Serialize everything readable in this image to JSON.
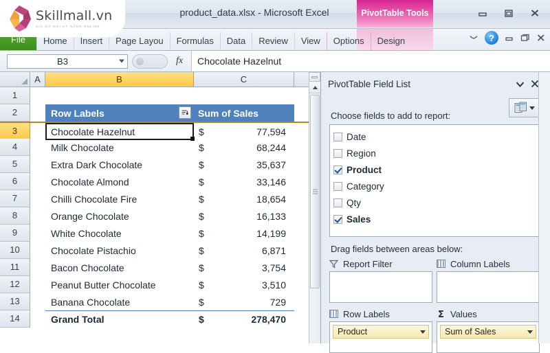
{
  "window": {
    "document_title": "product_data.xlsx - Microsoft Excel",
    "contextual_tab_badge": "PivotTable Tools",
    "minimize_label": "Minimize",
    "restore_label": "Restore Down",
    "close_label": "Close"
  },
  "watermark": {
    "name": "Skillmall.vn",
    "tagline": "GIA SƯ MỌI KỸ NĂNG ONLINE"
  },
  "ribbon": {
    "tabs": [
      {
        "label": "File",
        "type": "file"
      },
      {
        "label": "Home",
        "type": "normal"
      },
      {
        "label": "Insert",
        "type": "normal"
      },
      {
        "label": "Page Layou",
        "type": "normal"
      },
      {
        "label": "Formulas",
        "type": "normal"
      },
      {
        "label": "Data",
        "type": "normal"
      },
      {
        "label": "Review",
        "type": "normal"
      },
      {
        "label": "View",
        "type": "normal"
      },
      {
        "label": "Options",
        "type": "contextual"
      },
      {
        "label": "Design",
        "type": "contextual"
      }
    ],
    "help_label": "?",
    "accent_contextual": "#e0399c",
    "accent_file": "#4f9e27"
  },
  "formula_bar": {
    "name_box_value": "B3",
    "formula_value": "Chocolate Hazelnut",
    "fx_label": "fx"
  },
  "grid": {
    "columns": [
      "A",
      "B",
      "C"
    ],
    "selected_column": "B",
    "selected_row": "3",
    "active_cell": "B3",
    "rows": [
      {
        "num": "1",
        "label": "",
        "currency": "",
        "amount": "",
        "style": "blank"
      },
      {
        "num": "2",
        "label": "Row Labels",
        "currency": "",
        "amount": "Sum of Sales",
        "style": "header"
      },
      {
        "num": "3",
        "label": "Chocolate Hazelnut",
        "currency": "$",
        "amount": "77,594",
        "style": "data"
      },
      {
        "num": "4",
        "label": "Milk Chocolate",
        "currency": "$",
        "amount": "68,244",
        "style": "data"
      },
      {
        "num": "5",
        "label": "Extra Dark Chocolate",
        "currency": "$",
        "amount": "35,637",
        "style": "data"
      },
      {
        "num": "6",
        "label": "Chocolate Almond",
        "currency": "$",
        "amount": "33,146",
        "style": "data"
      },
      {
        "num": "7",
        "label": "Chilli Chocolate Fire",
        "currency": "$",
        "amount": "18,654",
        "style": "data"
      },
      {
        "num": "8",
        "label": "Orange Chocolate",
        "currency": "$",
        "amount": "16,133",
        "style": "data"
      },
      {
        "num": "9",
        "label": "White Chocolate",
        "currency": "$",
        "amount": "14,199",
        "style": "data"
      },
      {
        "num": "10",
        "label": "Chocolate Pistachio",
        "currency": "$",
        "amount": "6,871",
        "style": "data"
      },
      {
        "num": "11",
        "label": "Bacon Chocolate",
        "currency": "$",
        "amount": "3,754",
        "style": "data"
      },
      {
        "num": "12",
        "label": "Peanut Butter Chocolate",
        "currency": "$",
        "amount": "3,510",
        "style": "data"
      },
      {
        "num": "13",
        "label": "Banana Chocolate",
        "currency": "$",
        "amount": "729",
        "style": "data"
      },
      {
        "num": "14",
        "label": "Grand Total",
        "currency": "$",
        "amount": "278,470",
        "style": "grand"
      }
    ],
    "header_fill": "#4f81bd",
    "selection_fill": "#fdc745"
  },
  "field_list": {
    "title": "PivotTable Field List",
    "choose_label": "Choose fields to add to report:",
    "fields": [
      {
        "name": "Date",
        "checked": false
      },
      {
        "name": "Region",
        "checked": false
      },
      {
        "name": "Product",
        "checked": true
      },
      {
        "name": "Category",
        "checked": false
      },
      {
        "name": "Qty",
        "checked": false
      },
      {
        "name": "Sales",
        "checked": true
      }
    ],
    "drag_label": "Drag fields between areas below:",
    "areas": [
      {
        "name": "Report Filter",
        "icon": "funnel-icon",
        "items": []
      },
      {
        "name": "Column Labels",
        "icon": "grid-icon",
        "items": []
      },
      {
        "name": "Row Labels",
        "icon": "grid-icon",
        "items": [
          "Product"
        ]
      },
      {
        "name": "Values",
        "icon": "sigma-icon",
        "items": [
          "Sum of Sales"
        ]
      }
    ]
  }
}
